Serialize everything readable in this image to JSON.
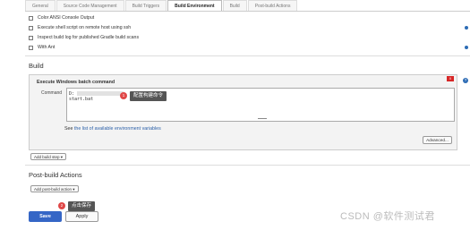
{
  "tabs": [
    {
      "label": "General",
      "active": false
    },
    {
      "label": "Source Code Management",
      "active": false
    },
    {
      "label": "Build Triggers",
      "active": false
    },
    {
      "label": "Build Environment",
      "active": true
    },
    {
      "label": "Build",
      "active": false
    },
    {
      "label": "Post-build Actions",
      "active": false
    }
  ],
  "build_env": {
    "options": [
      "Color ANSI Console Output",
      "Execute shell script on remote host using ssh",
      "Inspect build log for published Gradle build scans",
      "With Ant"
    ]
  },
  "build": {
    "section_title": "Build",
    "step_title": "Execute Windows batch command",
    "delete_label": "X",
    "help_label": "?",
    "command_label": "Command",
    "command_lines": [
      "D:",
      "start.bat"
    ],
    "see_prefix": "See ",
    "see_link": "the list of available environment variables",
    "advanced_label": "Advanced...",
    "add_step_label": "Add build step ▾"
  },
  "post_build": {
    "section_title": "Post-build Actions",
    "add_action_label": "Add post-build action ▾"
  },
  "annotations": [
    {
      "number": "1",
      "text": "配置构建命令"
    },
    {
      "number": "2",
      "text": "点击保存"
    }
  ],
  "footer": {
    "save_label": "Save",
    "apply_label": "Apply"
  },
  "watermark": "CSDN @软件测试君",
  "colors": {
    "accent": "#3566c6",
    "badge": "#e04848",
    "link": "#2a5fa8"
  }
}
